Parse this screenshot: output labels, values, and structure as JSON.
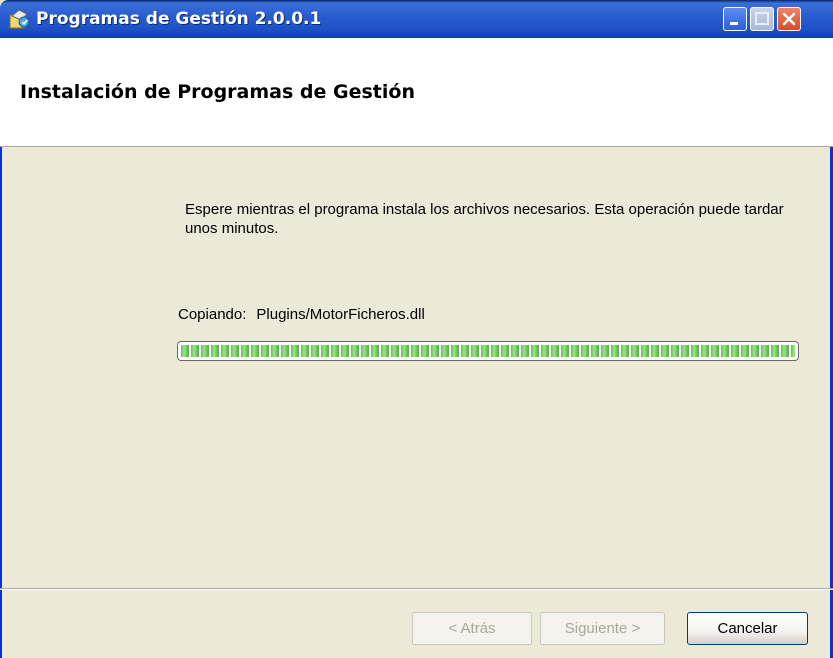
{
  "window": {
    "title": "Programas de Gestión 2.0.0.1"
  },
  "header": {
    "title": "Instalación de Programas de Gestión"
  },
  "content": {
    "instructions": "Espere mientras el programa instala los archivos necesarios. Esta operación puede tardar unos minutos.",
    "copy_label": "Copiando:",
    "copy_file": "Plugins/MotorFicheros.dll",
    "progress_fraction": 1.0
  },
  "buttons": {
    "back": "< Atrás",
    "next": "Siguiente >",
    "cancel": "Cancelar"
  },
  "icons": {
    "app": "installer-app-icon",
    "minimize": "minimize-icon",
    "maximize": "maximize-icon",
    "close": "close-icon"
  },
  "colors": {
    "titlebar": "#2a5ed0",
    "progress": "#5fc04a",
    "close_button": "#d94a26"
  }
}
